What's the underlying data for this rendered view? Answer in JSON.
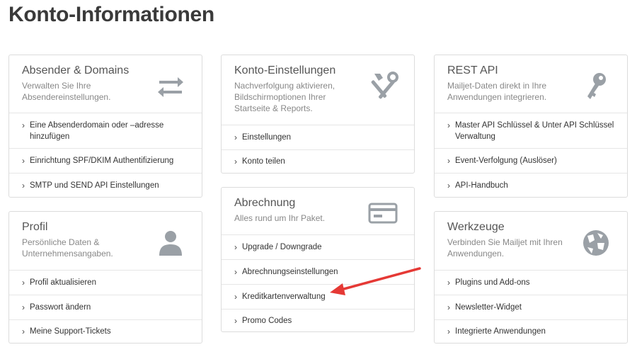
{
  "page_title": "Konto-Informationen",
  "cards": {
    "absender": {
      "title": "Absender & Domains",
      "desc": "Verwalten Sie Ihre Absendereinstellungen.",
      "icon": "arrows-swap-icon",
      "items": [
        "Eine Absenderdomain oder –adresse hinzufügen",
        "Einrichtung SPF/DKIM Authentifizierung",
        "SMTP und SEND API Einstellungen"
      ]
    },
    "profil": {
      "title": "Profil",
      "desc": "Persönliche Daten & Unternehmensangaben.",
      "icon": "user-icon",
      "items": [
        "Profil aktualisieren",
        "Passwort ändern",
        "Meine Support-Tickets"
      ]
    },
    "konto": {
      "title": "Konto-Einstellungen",
      "desc": "Nachverfolgung aktivieren, Bildschirmoptionen Ihrer Startseite & Reports.",
      "icon": "tools-icon",
      "items": [
        "Einstellungen",
        "Konto teilen"
      ]
    },
    "abrechnung": {
      "title": "Abrechnung",
      "desc": "Alles rund um Ihr Paket.",
      "icon": "credit-card-icon",
      "items": [
        "Upgrade / Downgrade",
        "Abrechnungseinstellungen",
        "Kreditkartenverwaltung",
        "Promo Codes"
      ]
    },
    "rest": {
      "title": "REST API",
      "desc": "Mailjet-Daten direkt in Ihre Anwendungen integrieren.",
      "icon": "key-icon",
      "items": [
        "Master API Schlüssel & Unter API Schlüssel Verwaltung",
        "Event-Verfolgung (Auslöser)",
        "API-Handbuch"
      ]
    },
    "werkzeuge": {
      "title": "Werkzeuge",
      "desc": "Verbinden Sie Mailjet mit Ihren Anwendungen.",
      "icon": "globe-icon",
      "items": [
        "Plugins und Add-ons",
        "Newsletter-Widget",
        "Integrierte Anwendungen"
      ]
    }
  },
  "chevron": "›",
  "colors": {
    "icon": "#9aa0a6",
    "annotation_arrow": "#e53935"
  }
}
